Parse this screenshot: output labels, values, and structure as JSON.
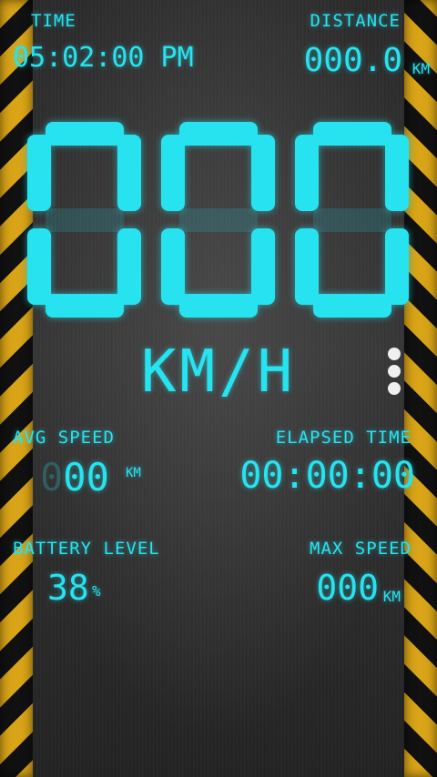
{
  "header": {
    "time_label": "TIME",
    "time_value": "05:02:00 PM",
    "distance_label": "DISTANCE",
    "distance_value": "000.0",
    "distance_unit": "KM"
  },
  "speedometer": {
    "speed_value": "000",
    "speed_unit": "KM/H"
  },
  "stats": {
    "avg_speed_label": "AVG SPEED",
    "avg_speed_ghost": "0",
    "avg_speed_value": "00",
    "avg_speed_unit": "KM",
    "elapsed_label": "ELAPSED TIME",
    "elapsed_value": "00:00:00",
    "battery_label": "BATTERY LEVEL",
    "battery_value": "38",
    "battery_unit": "%",
    "max_speed_label": "MAX SPEED",
    "max_speed_value": "000",
    "max_speed_unit": "KM"
  },
  "icons": {
    "menu": "more-vert-icon"
  },
  "colors": {
    "lcd": "#27e3f0",
    "stripe_yellow": "#d9a417",
    "stripe_black": "#111111"
  }
}
